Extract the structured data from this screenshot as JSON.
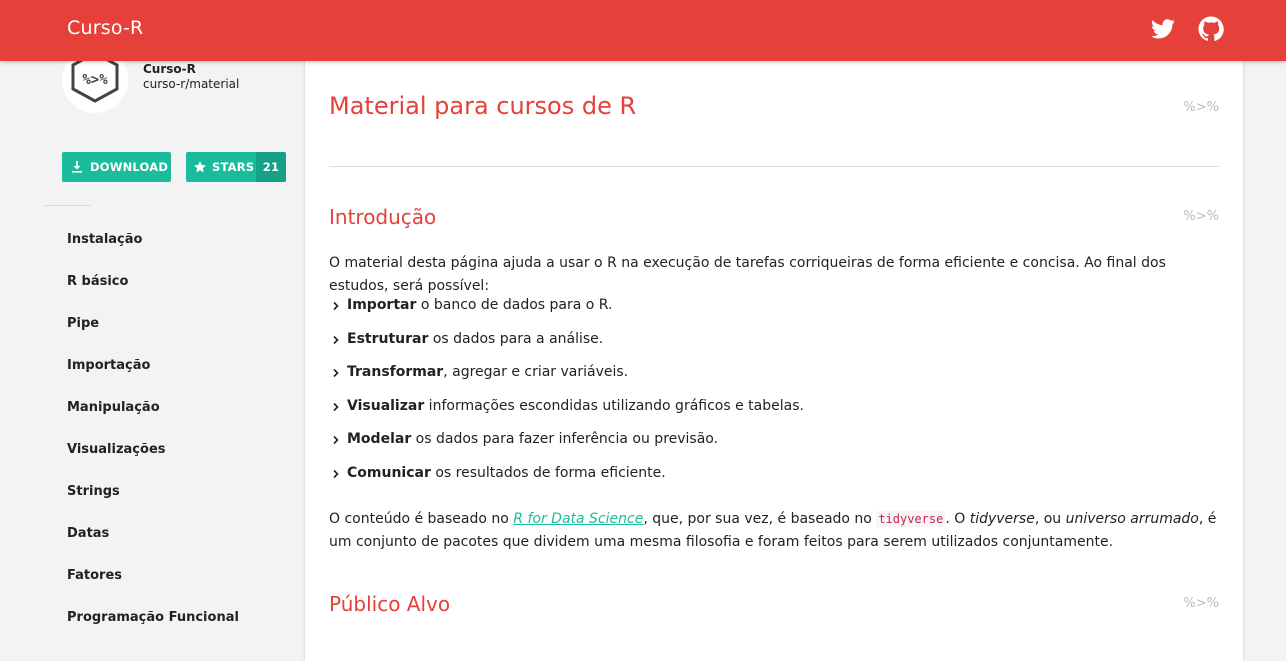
{
  "header": {
    "brand": "Curso-R",
    "icons": [
      "twitter-icon",
      "github-icon"
    ]
  },
  "sidebar": {
    "logo_text": "%>%",
    "owner": "Curso-R",
    "repo": "curso-r/material",
    "download_label": "DOWNLOAD",
    "stars_label": "STARS",
    "stars_count": "21",
    "nav": [
      "Instalação",
      "R básico",
      "Pipe",
      "Importação",
      "Manipulação",
      "Visualizações",
      "Strings",
      "Datas",
      "Fatores",
      "Programação Funcional"
    ]
  },
  "main": {
    "title": "Material para cursos de R",
    "pipe_marker": "%>%",
    "intro": {
      "heading": "Introdução",
      "paragraph": "O material desta página ajuda a usar o R na execução de tarefas corriqueiras de forma eficiente e concisa. Ao final dos estudos, será possível:",
      "bullets": [
        {
          "bold": "Importar",
          "rest": " o banco de dados para o R."
        },
        {
          "bold": "Estruturar",
          "rest": " os dados para a análise."
        },
        {
          "bold": "Transformar",
          "rest": ", agregar e criar variáveis."
        },
        {
          "bold": "Visualizar",
          "rest": " informações escondidas utilizando gráficos e tabelas."
        },
        {
          "bold": "Modelar",
          "rest": " os dados para fazer inferência ou previsão."
        },
        {
          "bold": "Comunicar",
          "rest": " os resultados de forma eficiente."
        }
      ],
      "p2_a": "O conteúdo é baseado no ",
      "p2_link": "R for Data Science",
      "p2_b": ", que, por sua vez, é baseado no ",
      "p2_code": "tidyverse",
      "p2_c": ". O ",
      "p2_em1": "tidyverse",
      "p2_d": ", ou ",
      "p2_em2": "universo arrumado",
      "p2_e": ", é um conjunto de pacotes que dividem uma mesma filosofia e foram feitos para serem utilizados conjuntamente."
    },
    "audience": {
      "heading": "Público Alvo"
    }
  },
  "colors": {
    "accent": "#e5403a",
    "teal": "#1abc9c",
    "teal_dark": "#16a085"
  }
}
